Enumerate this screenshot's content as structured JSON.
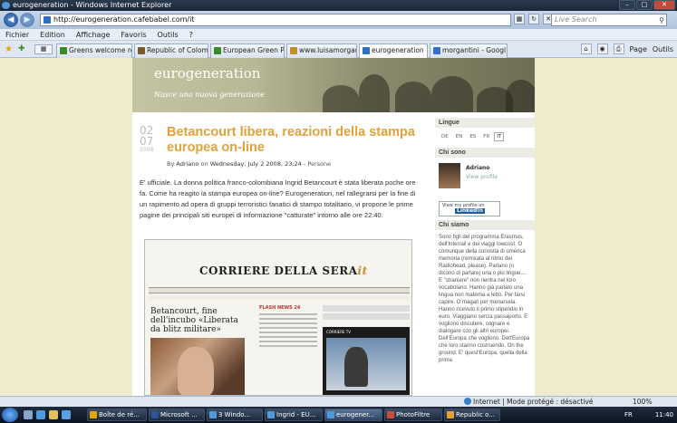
{
  "window": {
    "title": "eurogeneration - Windows Internet Explorer"
  },
  "address_bar": {
    "url": "http://eurogeneration.cafebabel.com/it",
    "search_placeholder": "Live Search"
  },
  "menu": [
    "Fichier",
    "Edition",
    "Affichage",
    "Favoris",
    "Outils",
    "?"
  ],
  "tabs": [
    {
      "label": "Greens welcome rel...",
      "icon_color": "#3a8a2a",
      "active": false
    },
    {
      "label": "Republic of Colom...",
      "icon_color": "#7a5a2a",
      "active": false
    },
    {
      "label": "European Green Pa...",
      "icon_color": "#3a8a2a",
      "active": false
    },
    {
      "label": "www.luisamorganti...",
      "icon_color": "#c09030",
      "active": false
    },
    {
      "label": "eurogeneration",
      "icon_color": "#2e6fc4",
      "active": true
    },
    {
      "label": "morgantini - Googl...",
      "icon_color": "#3a6ad0",
      "active": false
    }
  ],
  "command_bar": {
    "page_label": "Page",
    "tools_label": "Outils"
  },
  "blog": {
    "title": "eurogeneration",
    "subtitle": "Nasce una nuova generazione",
    "post": {
      "date_day": "02",
      "date_month": "07",
      "date_year": "2008",
      "title": "Betancourt libera, reazioni della stampa europea on-line",
      "meta_prefix": "By",
      "author": "Adriano",
      "meta_on": "on",
      "date_text": "Wednesday, July 2 2008, 23:24",
      "category": "Persone",
      "body": "E' ufficiale. La donna politica franco-colombiana Ingrid Betancourt è stata liberata poche ore fa. Come ha reagito la stampa europea on-line? Eurogeneration, nel rallegrarsi per la fine di un rapimento ad opera di gruppi terroristici fanatici di stampo totalitario, vi propone le prime pagine dei principali siti europei di informazione \"catturate\" intorno alle ore 22:40."
    },
    "newspaper": {
      "masthead": "CORRIERE DELLA SERA",
      "masthead_suffix": "it",
      "headline": "Betancourt, fine dell'incubo «Liberata da blitz militare»",
      "mid_label": "FLASH NEWS 24",
      "right_label": "CORRIERE TV"
    },
    "sidebar": {
      "lingue_heading": "Lingue",
      "languages": [
        "DE",
        "EN",
        "ES",
        "FR",
        "IT"
      ],
      "current_language": "IT",
      "chi_sono_heading": "Chi sono",
      "profile_name": "Adriano",
      "profile_link": "View profile",
      "linkedin_text": "View my profile on",
      "linkedin_brand": "LinkedIn",
      "chi_siamo_heading": "Chi siamo",
      "chi_siamo_text": "Sono figli del programma Erasmus, dell'Interrail e dei viaggi lowcost. O comunque della curiosita di omerica memoria (remixata al ritmo dei Radiohead, please). Parlano (o dicono di parlare) una o più lingue.... E \"straniere\" non rientra nel loro vocabolario. Hanno già parlato una lingua non materna a letto. Per farsi capire. O magari per menarsela. Hanno ricevuto il primo stipendio in euro. Viaggiano senza passaporto. E vogliono discutere, sognare e dialogare con gli altri europei. Dell'Europa che vogliono. Dell'Europa che loro stanno costruendo. On the ground. E' quest'Europa, quella della prima"
    }
  },
  "status_bar": {
    "zone_text": "Internet | Mode protégé : désactivé",
    "zoom": "100%"
  },
  "taskbar": {
    "tasks": [
      {
        "label": "Boîte de ré...",
        "icon_color": "#e0a800",
        "active": false
      },
      {
        "label": "Microsoft ...",
        "icon_color": "#2b579a",
        "active": false
      },
      {
        "label": "3 Windo...",
        "icon_color": "#4d9bd8",
        "active": false
      },
      {
        "label": "Ingrid - EU...",
        "icon_color": "#4d9bd8",
        "active": false
      },
      {
        "label": "eurogener...",
        "icon_color": "#4d9bd8",
        "active": true
      },
      {
        "label": "PhotoFiltre",
        "icon_color": "#d04a3a",
        "active": false
      },
      {
        "label": "Republic o...",
        "icon_color": "#e8a030",
        "active": false
      }
    ],
    "lang": "FR",
    "clock": "11:40"
  }
}
